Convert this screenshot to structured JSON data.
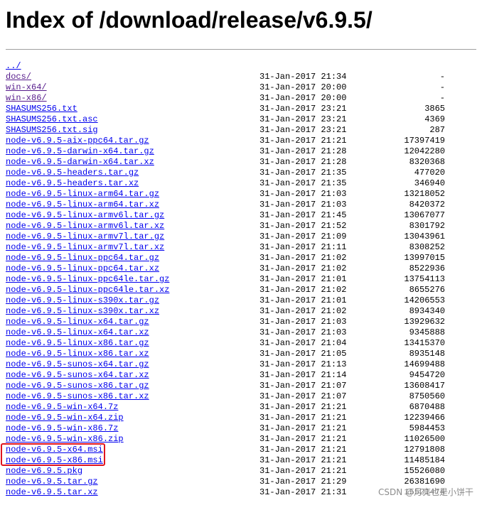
{
  "page": {
    "title": "Index of /download/release/v6.9.5/"
  },
  "files": [
    {
      "name": "../",
      "date": "",
      "size": "",
      "visited": false
    },
    {
      "name": "docs/",
      "date": "31-Jan-2017 21:34",
      "size": "-",
      "visited": true
    },
    {
      "name": "win-x64/",
      "date": "31-Jan-2017 20:00",
      "size": "-",
      "visited": true
    },
    {
      "name": "win-x86/",
      "date": "31-Jan-2017 20:00",
      "size": "-",
      "visited": true
    },
    {
      "name": "SHASUMS256.txt",
      "date": "31-Jan-2017 23:21",
      "size": "3865",
      "visited": false
    },
    {
      "name": "SHASUMS256.txt.asc",
      "date": "31-Jan-2017 23:21",
      "size": "4369",
      "visited": false
    },
    {
      "name": "SHASUMS256.txt.sig",
      "date": "31-Jan-2017 23:21",
      "size": "287",
      "visited": false
    },
    {
      "name": "node-v6.9.5-aix-ppc64.tar.gz",
      "date": "31-Jan-2017 21:21",
      "size": "17397419",
      "visited": false
    },
    {
      "name": "node-v6.9.5-darwin-x64.tar.gz",
      "date": "31-Jan-2017 21:28",
      "size": "12042280",
      "visited": false
    },
    {
      "name": "node-v6.9.5-darwin-x64.tar.xz",
      "date": "31-Jan-2017 21:28",
      "size": "8320368",
      "visited": false
    },
    {
      "name": "node-v6.9.5-headers.tar.gz",
      "date": "31-Jan-2017 21:35",
      "size": "477020",
      "visited": false
    },
    {
      "name": "node-v6.9.5-headers.tar.xz",
      "date": "31-Jan-2017 21:35",
      "size": "346940",
      "visited": false
    },
    {
      "name": "node-v6.9.5-linux-arm64.tar.gz",
      "date": "31-Jan-2017 21:03",
      "size": "13218052",
      "visited": false
    },
    {
      "name": "node-v6.9.5-linux-arm64.tar.xz",
      "date": "31-Jan-2017 21:03",
      "size": "8420372",
      "visited": false
    },
    {
      "name": "node-v6.9.5-linux-armv6l.tar.gz",
      "date": "31-Jan-2017 21:45",
      "size": "13067077",
      "visited": false
    },
    {
      "name": "node-v6.9.5-linux-armv6l.tar.xz",
      "date": "31-Jan-2017 21:52",
      "size": "8301792",
      "visited": false
    },
    {
      "name": "node-v6.9.5-linux-armv7l.tar.gz",
      "date": "31-Jan-2017 21:09",
      "size": "13043961",
      "visited": false
    },
    {
      "name": "node-v6.9.5-linux-armv7l.tar.xz",
      "date": "31-Jan-2017 21:11",
      "size": "8308252",
      "visited": false
    },
    {
      "name": "node-v6.9.5-linux-ppc64.tar.gz",
      "date": "31-Jan-2017 21:02",
      "size": "13997015",
      "visited": false
    },
    {
      "name": "node-v6.9.5-linux-ppc64.tar.xz",
      "date": "31-Jan-2017 21:02",
      "size": "8522936",
      "visited": false
    },
    {
      "name": "node-v6.9.5-linux-ppc64le.tar.gz",
      "date": "31-Jan-2017 21:01",
      "size": "13754113",
      "visited": false
    },
    {
      "name": "node-v6.9.5-linux-ppc64le.tar.xz",
      "date": "31-Jan-2017 21:02",
      "size": "8655276",
      "visited": false
    },
    {
      "name": "node-v6.9.5-linux-s390x.tar.gz",
      "date": "31-Jan-2017 21:01",
      "size": "14206553",
      "visited": false
    },
    {
      "name": "node-v6.9.5-linux-s390x.tar.xz",
      "date": "31-Jan-2017 21:02",
      "size": "8934340",
      "visited": false
    },
    {
      "name": "node-v6.9.5-linux-x64.tar.gz",
      "date": "31-Jan-2017 21:03",
      "size": "13929632",
      "visited": false
    },
    {
      "name": "node-v6.9.5-linux-x64.tar.xz",
      "date": "31-Jan-2017 21:03",
      "size": "9345888",
      "visited": false
    },
    {
      "name": "node-v6.9.5-linux-x86.tar.gz",
      "date": "31-Jan-2017 21:04",
      "size": "13415370",
      "visited": false
    },
    {
      "name": "node-v6.9.5-linux-x86.tar.xz",
      "date": "31-Jan-2017 21:05",
      "size": "8935148",
      "visited": false
    },
    {
      "name": "node-v6.9.5-sunos-x64.tar.gz",
      "date": "31-Jan-2017 21:13",
      "size": "14699488",
      "visited": false
    },
    {
      "name": "node-v6.9.5-sunos-x64.tar.xz",
      "date": "31-Jan-2017 21:14",
      "size": "9454720",
      "visited": false
    },
    {
      "name": "node-v6.9.5-sunos-x86.tar.gz",
      "date": "31-Jan-2017 21:07",
      "size": "13608417",
      "visited": false
    },
    {
      "name": "node-v6.9.5-sunos-x86.tar.xz",
      "date": "31-Jan-2017 21:07",
      "size": "8750560",
      "visited": false
    },
    {
      "name": "node-v6.9.5-win-x64.7z",
      "date": "31-Jan-2017 21:21",
      "size": "6870488",
      "visited": false
    },
    {
      "name": "node-v6.9.5-win-x64.zip",
      "date": "31-Jan-2017 21:21",
      "size": "12239466",
      "visited": false
    },
    {
      "name": "node-v6.9.5-win-x86.7z",
      "date": "31-Jan-2017 21:21",
      "size": "5984453",
      "visited": false
    },
    {
      "name": "node-v6.9.5-win-x86.zip",
      "date": "31-Jan-2017 21:21",
      "size": "11026500",
      "visited": false
    },
    {
      "name": "node-v6.9.5-x64.msi",
      "date": "31-Jan-2017 21:21",
      "size": "12791808",
      "visited": false
    },
    {
      "name": "node-v6.9.5-x86.msi",
      "date": "31-Jan-2017 21:21",
      "size": "11485184",
      "visited": false
    },
    {
      "name": "node-v6.9.5.pkg",
      "date": "31-Jan-2017 21:21",
      "size": "15526080",
      "visited": false
    },
    {
      "name": "node-v6.9.5.tar.gz",
      "date": "31-Jan-2017 21:29",
      "size": "26381690",
      "visited": false
    },
    {
      "name": "node-v6.9.5.tar.xz",
      "date": "31-Jan-2017 21:31",
      "size": "15521474",
      "visited": false
    }
  ],
  "annotation": {
    "highlight_color": "#e0141e"
  },
  "colors": {
    "link": "#0000ee",
    "visited_link": "#551a8b"
  },
  "watermark": {
    "text": "CSDN @月亮也是小饼干"
  }
}
